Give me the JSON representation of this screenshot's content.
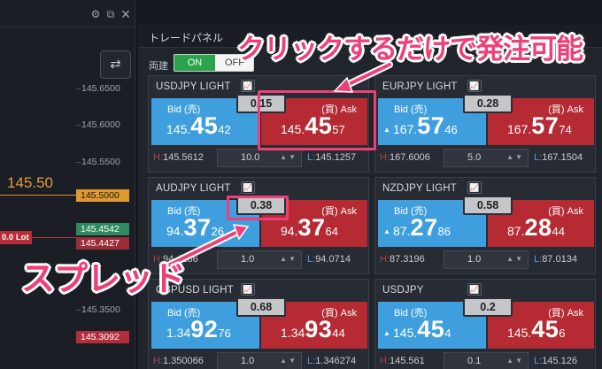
{
  "chart": {
    "current_price": "145.50",
    "axis": [
      "145.6500",
      "145.6000",
      "145.5500",
      "145.4542",
      "145.3500",
      "145.3092"
    ],
    "tags": {
      "orange": "145.5000",
      "green": "145.4542",
      "red_top": "145.4427",
      "red_bottom": "145.3092"
    },
    "lot_tag": "0.0 Lot",
    "icons": [
      "gear-icon",
      "popout-icon",
      "close-icon"
    ]
  },
  "panel": {
    "title": "トレードパネル",
    "ryoudate_label": "両建",
    "toggle": {
      "on": "ON",
      "off": "OFF"
    },
    "colors": {
      "bid": "#3f9fde",
      "ask": "#b52a33",
      "toggle_on": "#2aa34a",
      "annotation": "#ef3f78"
    },
    "cards": [
      {
        "symbol": "USDJPY LIGHT",
        "bid_label": "Bid (売)",
        "ask_label": "(買) Ask",
        "bid": {
          "pre": "145.",
          "big": "45",
          "tail": "42"
        },
        "ask": {
          "pre": "145.",
          "big": "45",
          "tail": "57"
        },
        "spread": "0.15",
        "high": "145.5612",
        "lot": "10.0",
        "low": "145.1257"
      },
      {
        "symbol": "EURJPY LIGHT",
        "bid_label": "Bid (売)",
        "ask_label": "(買) Ask",
        "bid": {
          "pre": "167.",
          "big": "57",
          "tail": "46"
        },
        "ask": {
          "pre": "167.",
          "big": "57",
          "tail": "74"
        },
        "spread": "0.28",
        "high": "167.6006",
        "lot": "5.0",
        "low": "167.1504"
      },
      {
        "symbol": "AUDJPY LIGHT",
        "bid_label": "Bid (売)",
        "ask_label": "(買) Ask",
        "bid": {
          "pre": "94.",
          "big": "37",
          "tail": "26"
        },
        "ask": {
          "pre": "94.",
          "big": "37",
          "tail": "64"
        },
        "spread": "0.38",
        "high": "94.4186",
        "lot": "1.0",
        "low": "94.0714"
      },
      {
        "symbol": "NZDJPY LIGHT",
        "bid_label": "Bid (売)",
        "ask_label": "(買) Ask",
        "bid": {
          "pre": "87.",
          "big": "27",
          "tail": "86"
        },
        "ask": {
          "pre": "87.",
          "big": "28",
          "tail": "44"
        },
        "spread": "0.58",
        "high": "87.3196",
        "lot": "1.0",
        "low": "87.0134"
      },
      {
        "symbol": "GBPUSD LIGHT",
        "bid_label": "Bid (売)",
        "ask_label": "(買) Ask",
        "bid": {
          "pre": "1.34",
          "big": "92",
          "tail": "76"
        },
        "ask": {
          "pre": "1.34",
          "big": "93",
          "tail": "44"
        },
        "spread": "0.68",
        "high": "1.350066",
        "lot": "1.0",
        "low": "1.346274"
      },
      {
        "symbol": "USDJPY",
        "bid_label": "Bid (売)",
        "ask_label": "(買) Ask",
        "bid": {
          "pre": "145.",
          "big": "45",
          "tail": "4"
        },
        "ask": {
          "pre": "145.",
          "big": "45",
          "tail": "6"
        },
        "spread": "0.2",
        "high": "145.561",
        "lot": "0.1",
        "low": "145.126"
      }
    ]
  },
  "annotations": {
    "click_text": "クリックするだけで発注可能",
    "spread_text": "スプレッド"
  }
}
